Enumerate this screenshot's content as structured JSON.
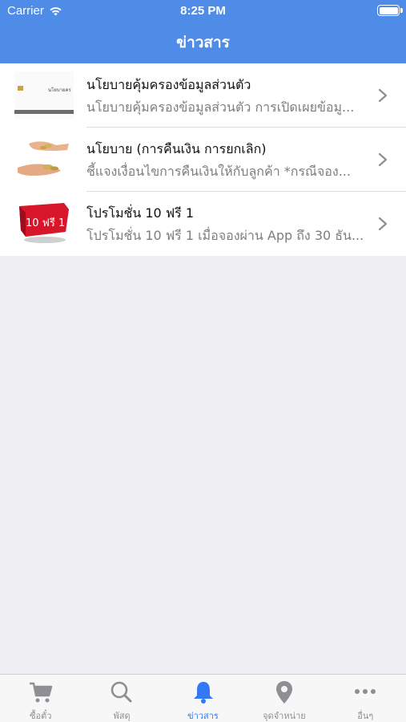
{
  "status_bar": {
    "carrier": "Carrier",
    "time": "8:25 PM"
  },
  "nav": {
    "title": "ข่าวสาร"
  },
  "news": [
    {
      "title": "นโยบายคุ้มครองข้อมูลส่วนตัว",
      "subtitle": "นโยบายคุ้มครองข้อมูลส่วนตัว การเปิดเผยข้อมู...",
      "thumb_caption": "นโยบายคร"
    },
    {
      "title": "นโยบาย (การคืนเงิน การยกเลิก)",
      "subtitle": "ชี้แจงเงื่อนไขการคืนเงินให้กับลูกค้า *กรณีจอง..."
    },
    {
      "title": "โปรโมชั่น 10 ฟรี 1",
      "subtitle": "โปรโมชั่น 10 ฟรี 1 เมื่อจองผ่าน App ถึง 30 ธัน...",
      "thumb_caption": "10 ฟรี 1"
    }
  ],
  "tabs": [
    {
      "label": "ซื้อตั๋ว",
      "icon": "cart-icon"
    },
    {
      "label": "พัสดุ",
      "icon": "search-icon"
    },
    {
      "label": "ข่าวสาร",
      "icon": "bell-icon",
      "active": true
    },
    {
      "label": "จุดจำหน่าย",
      "icon": "location-pin-icon"
    },
    {
      "label": "อื่นๆ",
      "icon": "more-icon"
    }
  ],
  "colors": {
    "accent": "#4f8ce8",
    "tab_active": "#3478f6",
    "tab_inactive": "#8e8e93",
    "background": "#efeff4"
  }
}
